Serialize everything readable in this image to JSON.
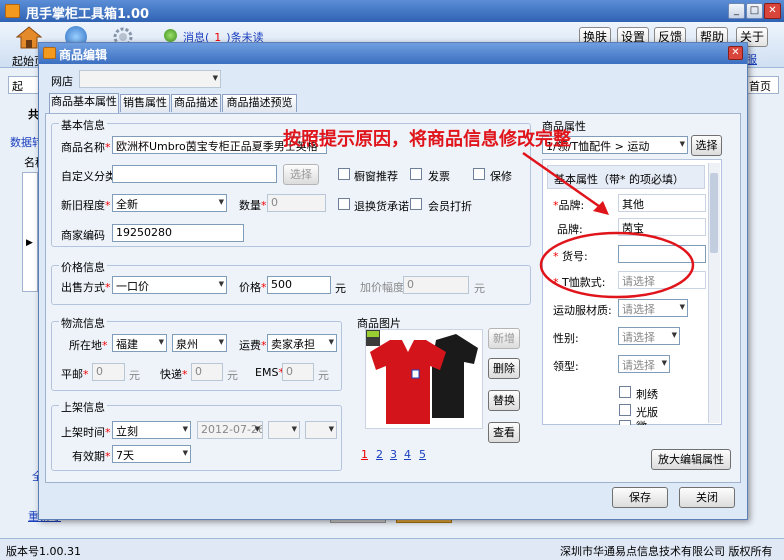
{
  "app": {
    "title": "甩手掌柜工具箱1.00",
    "toolbar_left": [
      "起始页"
    ],
    "message_prefix": "消息(",
    "message_count": "1",
    "message_suffix": ")条未读",
    "buttons": [
      "换肤",
      "设置",
      "反馈",
      "帮助",
      "关于"
    ],
    "right_tab": "首页",
    "right_tab2": "服",
    "left_tab_text": "起",
    "left_side": [
      "共",
      "数据转",
      "名称"
    ],
    "left_side_bottom": [
      "全",
      "重新导"
    ],
    "version": "版本号1.00.31",
    "company": "深圳市华通易点信息技术有限公司 版权所有"
  },
  "dialog": {
    "title": "商品编辑",
    "shop_label": "网店",
    "shop_value": "",
    "tabs": [
      "商品基本属性",
      "销售属性",
      "商品描述",
      "商品描述预览"
    ],
    "annotation": "按照提示原因，将商品信息修改完整",
    "basic": {
      "title": "基本信息",
      "name_label": "商品名称",
      "name_value": "欧洲杯Umbro茵宝专柜正品夏季男士英格",
      "custom_cat_label": "自定义分类",
      "select_btn": "选择",
      "checks": [
        "橱窗推荐",
        "发票",
        "保修",
        "退换货承诺",
        "会员打折"
      ],
      "condition_label": "新旧程度",
      "condition_value": "全新",
      "qty_label": "数量",
      "qty_value": "0",
      "code_label": "商家编码",
      "code_value": "19250280"
    },
    "price": {
      "title": "价格信息",
      "method_label": "出售方式",
      "method_value": "一口价",
      "price_label": "价格",
      "price_value": "500",
      "unit": "元",
      "markup_label": "加价幅度",
      "markup_value": "0",
      "unit2": "元"
    },
    "logistics": {
      "title": "物流信息",
      "location_label": "所在地",
      "province": "福建",
      "city": "泉州",
      "freight_label": "运费",
      "freight_value": "卖家承担",
      "mail_label": "平邮",
      "mail_value": "0",
      "express_label": "快递",
      "express_value": "0",
      "ems_label": "EMS",
      "ems_value": "0",
      "unit": "元"
    },
    "listing": {
      "title": "上架信息",
      "time_label": "上架时间",
      "time_value": "立刻",
      "date_value": "2012-07-26",
      "valid_label": "有效期",
      "valid_value": "7天"
    },
    "images": {
      "title": "商品图片",
      "buttons": [
        "新增",
        "删除",
        "替换",
        "查看"
      ],
      "pages": [
        "1",
        "2",
        "3",
        "4",
        "5"
      ]
    },
    "props": {
      "title": "商品属性",
      "category": "1/领/T恤配件 > 运动",
      "choose_btn": "选择",
      "section_title": "基本属性（带* 的项必填）",
      "rows": [
        {
          "label": "品牌:",
          "req": true,
          "value": "其他"
        },
        {
          "label": "品牌:",
          "req": false,
          "value": "茵宝"
        },
        {
          "label": "货号:",
          "req": true,
          "value": ""
        },
        {
          "label": "T恤款式:",
          "req": true,
          "value": "请选择"
        },
        {
          "label": "运动服材质:",
          "req": false,
          "value": "请选择"
        },
        {
          "label": "性别:",
          "req": false,
          "value": "请选择"
        },
        {
          "label": "领型:",
          "req": false,
          "value": "请选择"
        }
      ],
      "checkbox_options": [
        "刺绣",
        "光版",
        "微"
      ],
      "enlarge_btn": "放大编辑属性"
    },
    "save_btn": "保存",
    "close_btn": "关闭"
  },
  "colors": {
    "annotation": "#e0151b",
    "title_bar": "#3b6fc0",
    "required": "#e00000"
  }
}
